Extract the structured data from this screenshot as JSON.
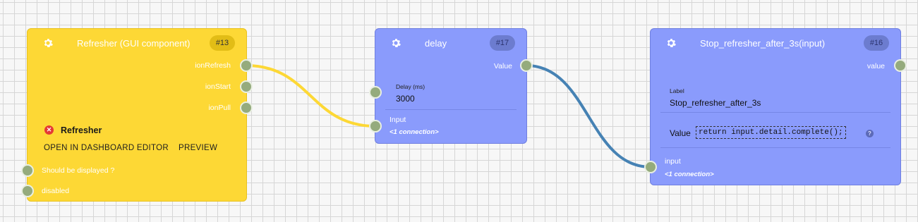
{
  "nodes": {
    "refresher": {
      "title": "Refresher (GUI component)",
      "id": "#13",
      "outputs": [
        "ionRefresh",
        "ionStart",
        "ionPull"
      ],
      "status_text": "Refresher",
      "status_icon": "error-x-icon",
      "actions": [
        "OPEN IN DASHBOARD EDITOR",
        "PREVIEW"
      ],
      "inputs": [
        "Should be displayed ?",
        "disabled"
      ],
      "color": "#fdd835"
    },
    "delay": {
      "title": "delay",
      "id": "#17",
      "output": "Value",
      "field_label": "Delay (ms)",
      "field_value": "3000",
      "input_label": "Input",
      "connections": "<1 connection>",
      "color": "#8a9bfc"
    },
    "stop": {
      "title": "Stop_refresher_after_3s(input)",
      "id": "#16",
      "output": "value",
      "field_label": "Label",
      "field_value": "Stop_refresher_after_3s",
      "value_label": "Value",
      "code": "return input.detail.complete();",
      "input_label": "input",
      "connections": "<1 connection>",
      "color": "#8a9bfc"
    }
  },
  "wires": [
    {
      "from": "Refresher (GUI component).ionRefresh",
      "to": "delay.Input",
      "color": "#fdd835"
    },
    {
      "from": "delay.Value",
      "to": "Stop_refresher_after_3s(input).input",
      "color": "#4682b4"
    }
  ],
  "icons": {
    "gear": "gear-icon",
    "help": "help-icon",
    "port": "port-icon"
  }
}
